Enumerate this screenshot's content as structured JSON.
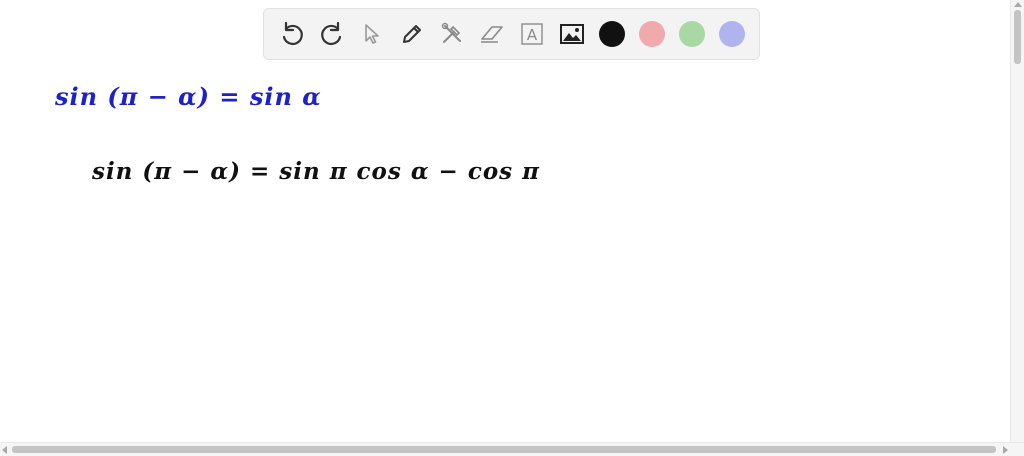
{
  "toolbar": {
    "tools": [
      {
        "icon": "undo-icon"
      },
      {
        "icon": "redo-icon"
      },
      {
        "icon": "pointer-icon"
      },
      {
        "icon": "pen-icon"
      },
      {
        "icon": "tools-icon"
      },
      {
        "icon": "eraser-icon"
      },
      {
        "icon": "text-icon",
        "glyph": "A"
      },
      {
        "icon": "image-icon"
      }
    ],
    "colors": {
      "black": "#111111",
      "red": "#f0a9ad",
      "green": "#a8d8a4",
      "blue": "#afb3ee"
    }
  },
  "whiteboard": {
    "line1": {
      "text": "sin (π − α) = sin α",
      "color": "#1d21c9"
    },
    "line2": {
      "text": "sin (π − α) = sin π  cos α  − cos π",
      "color": "#111111"
    }
  }
}
